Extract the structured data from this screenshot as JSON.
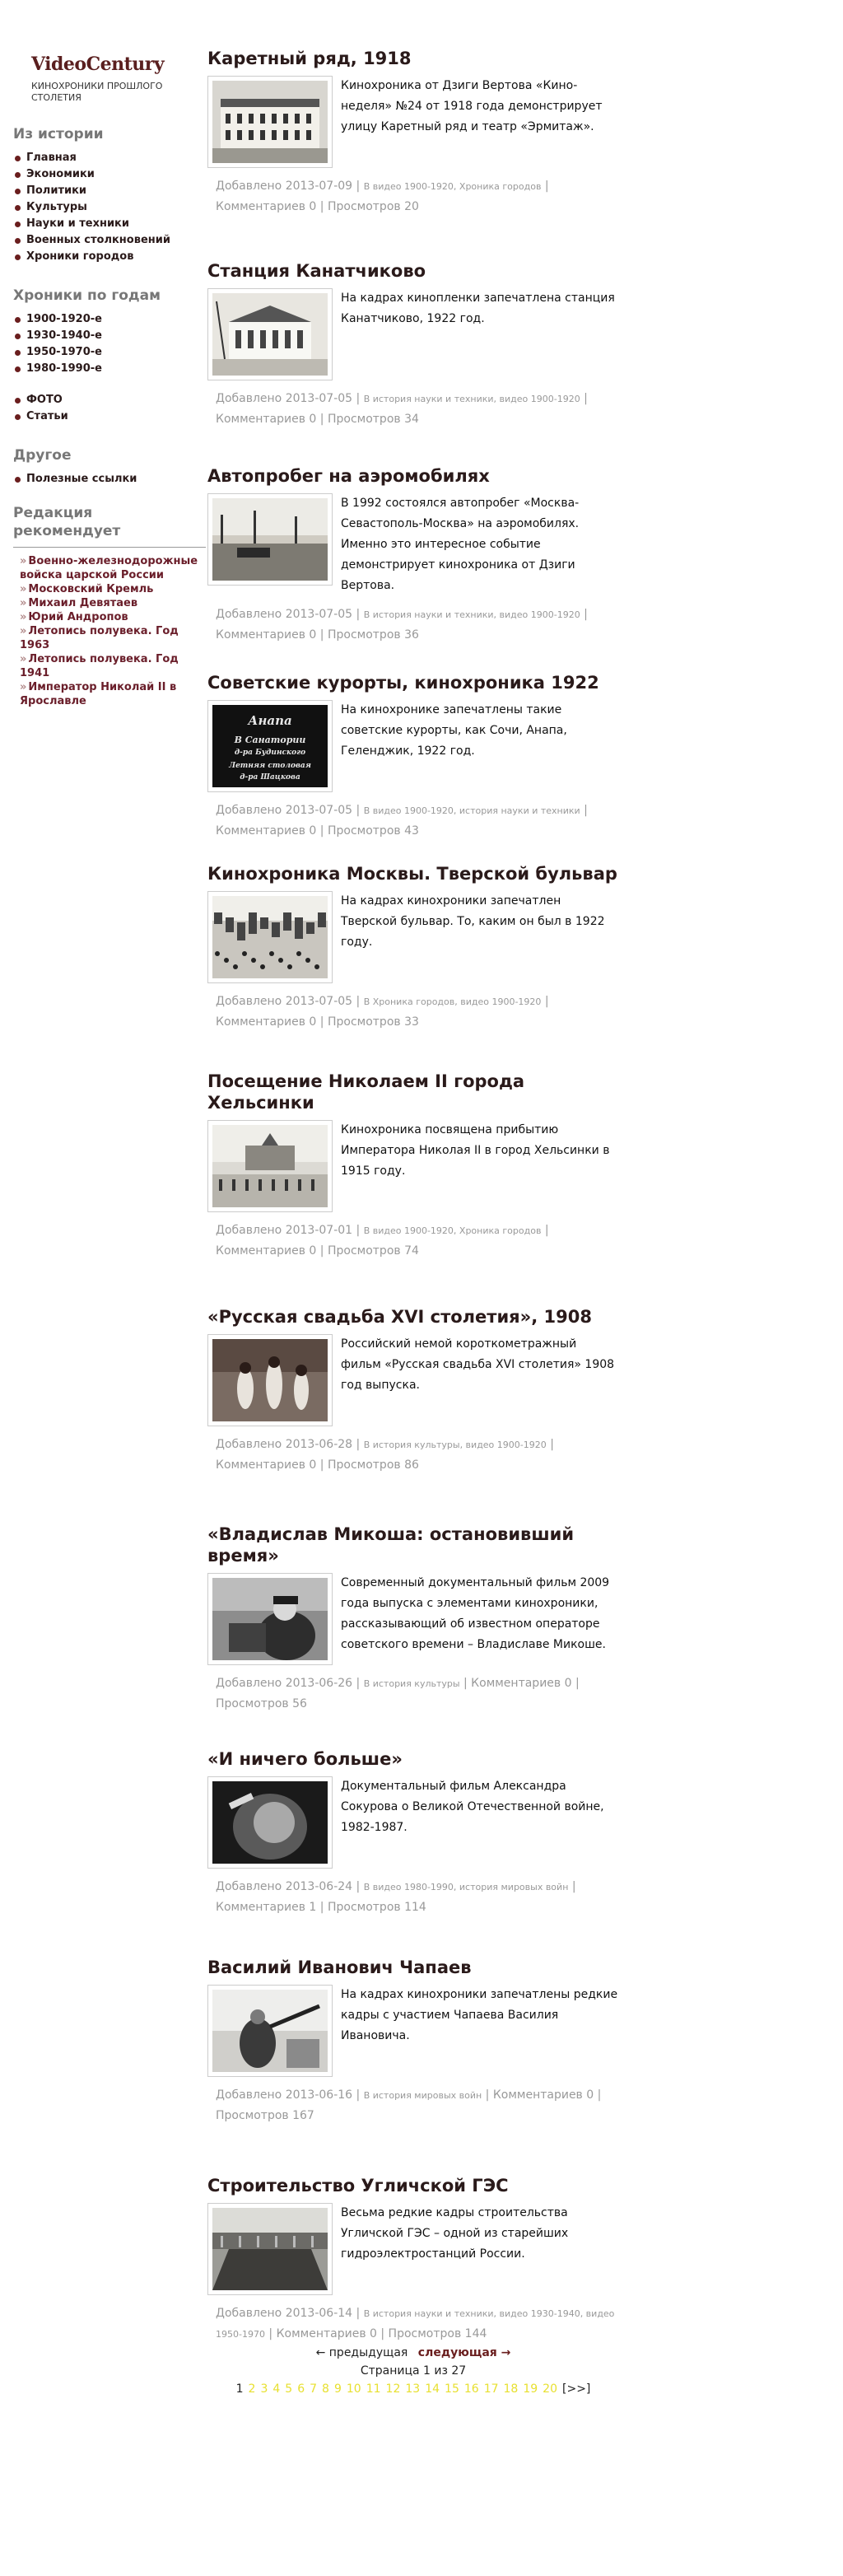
{
  "site": {
    "title": "VideoCentury",
    "subtitle": "КИНОХРОНИКИ ПРОШЛОГО СТОЛЕТИЯ"
  },
  "sidebar": {
    "history_heading": "Из истории",
    "history_items": [
      "Главная",
      "Экономики",
      "Политики",
      "Культуры",
      "Науки и техники",
      "Военных столкновений",
      "Хроники городов"
    ],
    "years_heading": "Хроники по годам",
    "years_items": [
      "1900-1920-е",
      "1930-1940-е",
      "1950-1970-е",
      "1980-1990-е"
    ],
    "extra_items": [
      "ФОТО",
      "Статьи"
    ],
    "other_heading": "Другое",
    "other_items": [
      "Полезные ссылки"
    ],
    "editor_heading": "Редакция рекомендует",
    "editor_items": [
      "Военно-железнодорожные войска царской России",
      "Московский Кремль",
      "Михаил Девятаев",
      "Юрий Андропов",
      "Летопись полувека. Год 1963",
      "Летопись полувека. Год 1941",
      "Император Николай II в Ярославле"
    ]
  },
  "posts": [
    {
      "title": "Каретный ряд, 1918",
      "excerpt": "Кинохроника от Дзиги Вертова «Кино-неделя» №24 от 1918 года демонстрирует улицу Каретный ряд и театр «Эрмитаж».",
      "added": "Добавлено 2013-07-09 |",
      "cats": "В видео 1900-1920, Хроника городов",
      "comments": "| Комментариев 0 |",
      "views": "Просмотров 20"
    },
    {
      "title": "Станция Канатчиково",
      "excerpt": "На кадрах кинопленки запечатлена станция Канатчиково, 1922 год.",
      "added": "Добавлено 2013-07-05 |",
      "cats": "В история науки и техники, видео 1900-1920",
      "comments": "| Комментариев 0 |",
      "views": "Просмотров 34"
    },
    {
      "title": "Автопробег на аэромобилях",
      "excerpt": "В 1992 состоялся автопробег «Москва-Севастополь-Москва» на аэромобилях. Именно это интересное событие демонстрирует кинохроника от Дзиги Вертова.",
      "added": "Добавлено 2013-07-05 |",
      "cats": "В история науки и техники, видео 1900-1920",
      "comments": "| Комментариев 0 |",
      "views": "Просмотров 36"
    },
    {
      "title": "Советские курорты, кинохроника 1922",
      "excerpt": "На кинохронике запечатлены такие советские курорты, как Сочи, Анапа, Геленджик, 1922 год.",
      "added": "Добавлено 2013-07-05 |",
      "cats": "В видео 1900-1920, история науки и техники",
      "comments": "| Комментариев 0 |",
      "views": "Просмотров 43",
      "thumb_text": [
        "Анапа",
        "В Санатории",
        "д-ра Будинского",
        "Летняя столовая",
        "д-ра Шацкова"
      ]
    },
    {
      "title": "Кинохроника Москвы. Тверской бульвар",
      "excerpt": "На кадрах кинохроники запечатлен Тверской бульвар. То, каким он был в 1922 году.",
      "added": "Добавлено 2013-07-05 |",
      "cats": "В Хроника городов, видео 1900-1920",
      "comments": "| Комментариев 0 |",
      "views": "Просмотров 33"
    },
    {
      "title": "Посещение Николаем II города Хельсинки",
      "excerpt": "Кинохроника посвящена прибытию Императора Николая II в город Хельсинки в 1915 году.",
      "added": "Добавлено 2013-07-01 |",
      "cats": "В видео 1900-1920, Хроника городов",
      "comments": "| Комментариев 0 |",
      "views": "Просмотров 74"
    },
    {
      "title": "«Русская свадьба XVI столетия», 1908",
      "excerpt": "Российский немой короткометражный фильм «Русская свадьба XVI столетия» 1908 год выпуска.",
      "added": "Добавлено 2013-06-28 |",
      "cats": "В история культуры, видео 1900-1920",
      "comments": "| Комментариев 0 |",
      "views": "Просмотров 86"
    },
    {
      "title": "«Владислав Микоша: остановивший время»",
      "excerpt": "Современный документальный фильм 2009 года выпуска с элементами кинохроники, рассказывающий об известном операторе советского времени – Владиславе Микоше.",
      "added": "Добавлено 2013-06-26 |",
      "cats": "В история культуры",
      "comments": "| Комментариев 0 |",
      "views": "Просмотров 56"
    },
    {
      "title": "«И ничего больше»",
      "excerpt": "Документальный фильм Александра Сокурова о Великой Отечественной войне, 1982-1987.",
      "added": "Добавлено 2013-06-24 |",
      "cats": "В видео 1980-1990, история мировых войн",
      "comments": "| Комментариев 1 |",
      "views": "Просмотров 114"
    },
    {
      "title": "Василий Иванович Чапаев",
      "excerpt": "На кадрах кинохроники запечатлены редкие кадры с участием Чапаева Василия Ивановича.",
      "added": "Добавлено 2013-06-16 |",
      "cats": "В история мировых войн",
      "comments": "| Комментариев 0 |",
      "views": "Просмотров 167"
    },
    {
      "title": "Строительство Угличской ГЭС",
      "excerpt": "Весьма редкие кадры строительства Угличской ГЭС – одной из старейших гидроэлектростанций России.",
      "added": "Добавлено 2013-06-14 |",
      "cats": "В история науки и техники, видео 1930-1940, видео 1950-1970",
      "comments": "| Комментариев 0 |",
      "views": "Просмотров 144"
    }
  ],
  "pagination": {
    "prev": "← предыдущая",
    "next": "следующая →",
    "info": "Страница 1 из 27",
    "current": "1",
    "pages": [
      "2",
      "3",
      "4",
      "5",
      "6",
      "7",
      "8",
      "9",
      "10",
      "11",
      "12",
      "13",
      "14",
      "15",
      "16",
      "17",
      "18",
      "19",
      "20"
    ],
    "more": "[>>]"
  }
}
